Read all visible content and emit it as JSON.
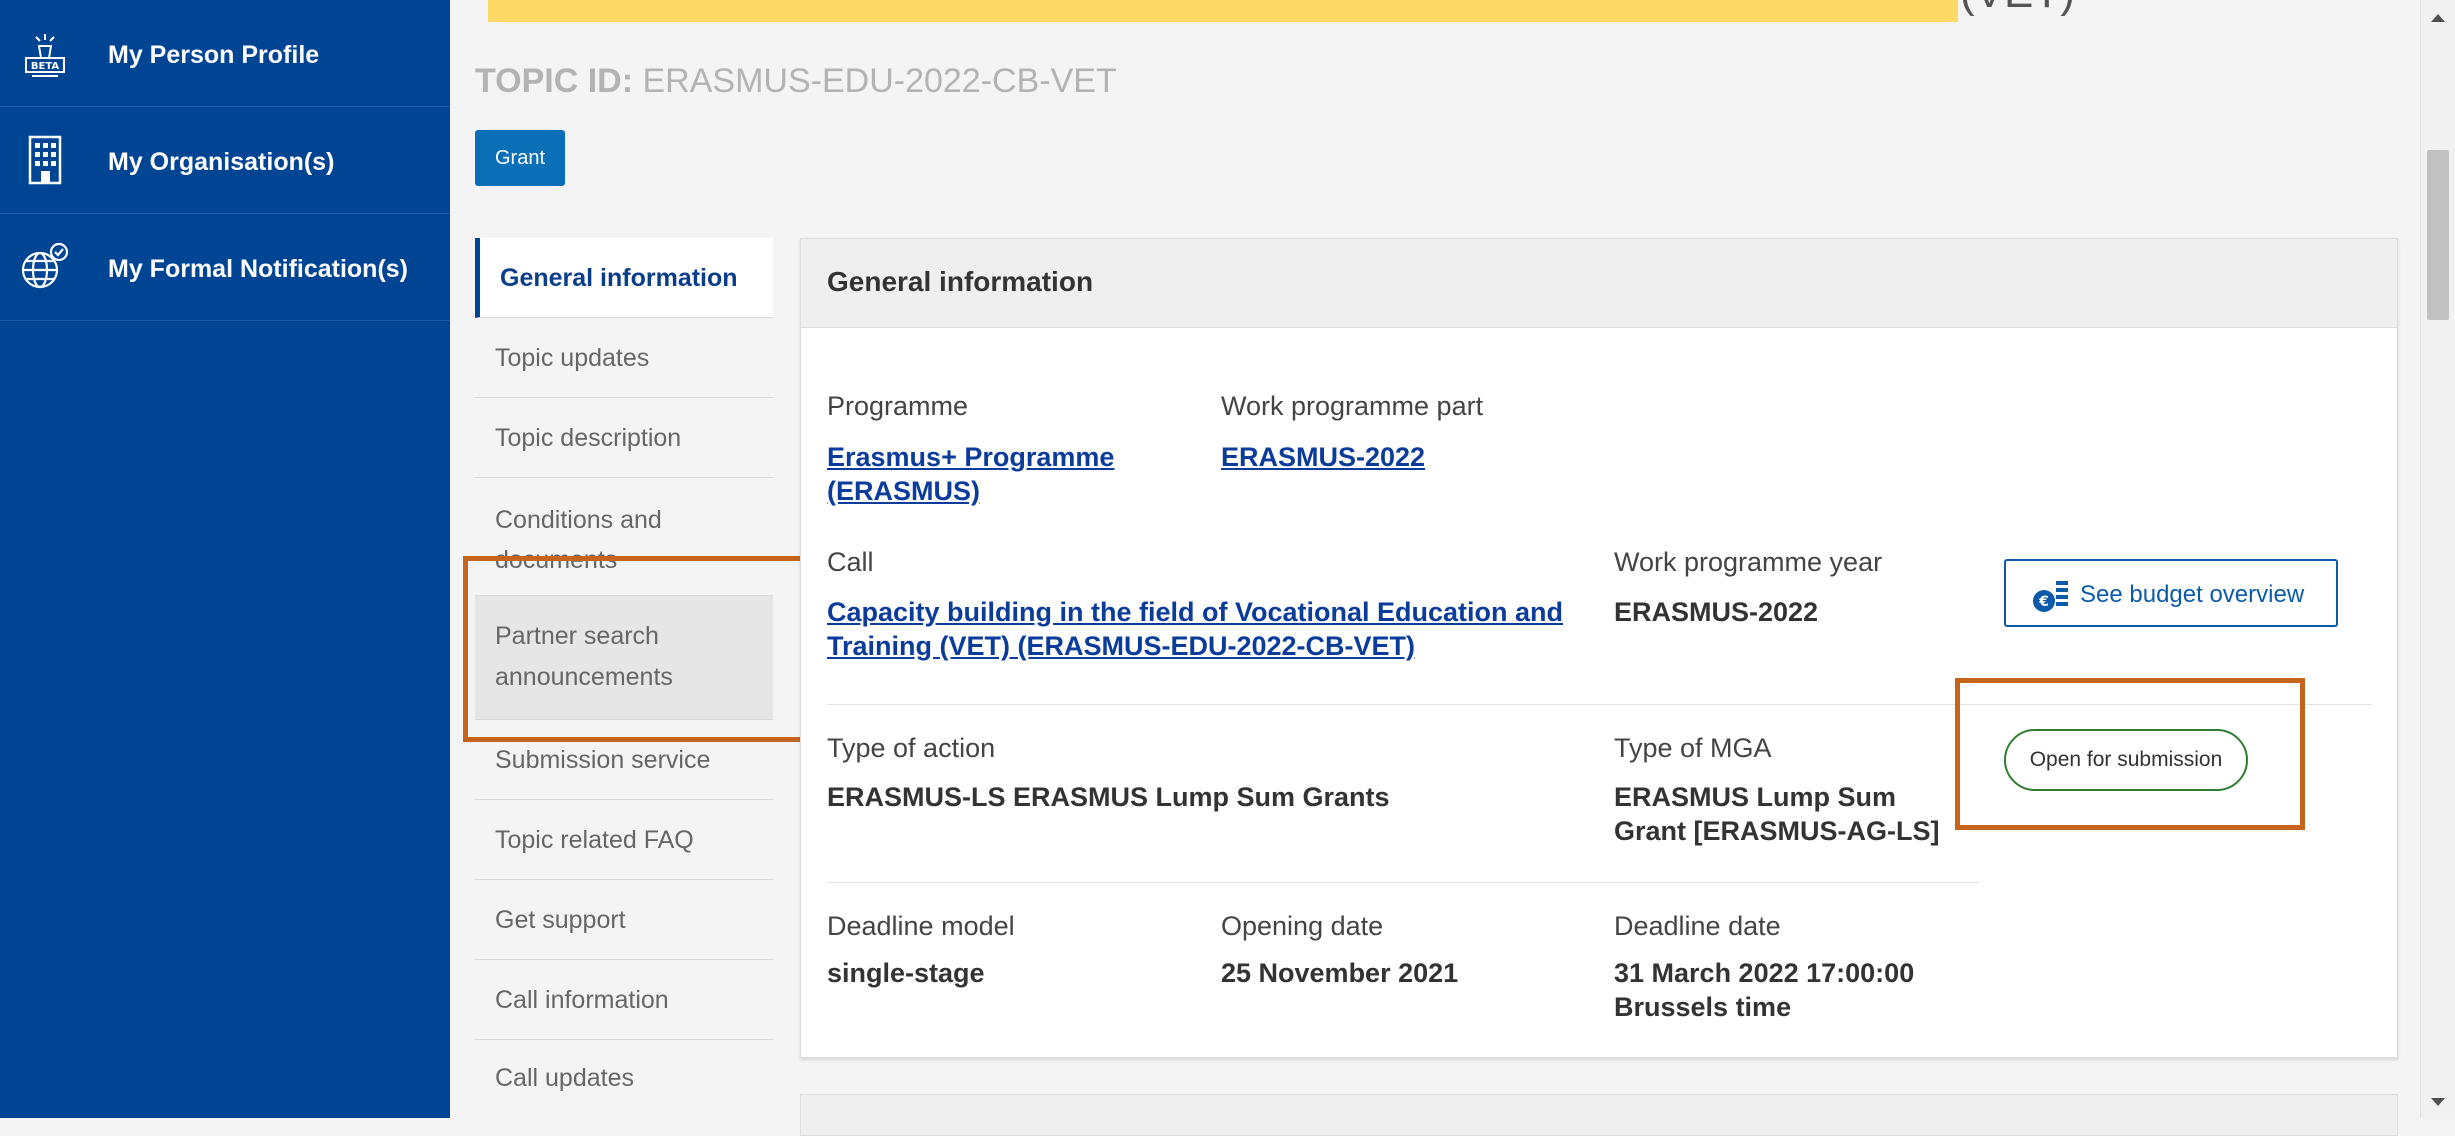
{
  "nav": {
    "items": [
      {
        "label": "My Person Profile",
        "icon": "beta-lighthouse-icon"
      },
      {
        "label": "My Organisation(s)",
        "icon": "building-icon"
      },
      {
        "label": "My Formal Notification(s)",
        "icon": "globe-notification-icon"
      }
    ]
  },
  "header": {
    "title_tail": "(VET)",
    "topic_id_label": "TOPIC ID:",
    "topic_id": "ERASMUS-EDU-2022-CB-VET",
    "badge": "Grant"
  },
  "menu": {
    "items": [
      "General information",
      "Topic updates",
      "Topic description",
      "Conditions and documents",
      "Partner search announcements",
      "Submission service",
      "Topic related FAQ",
      "Get support",
      "Call information",
      "Call updates"
    ]
  },
  "panel": {
    "title": "General information",
    "programme_label": "Programme",
    "programme_value": "Erasmus+ Programme (ERASMUS)",
    "wpp_label": "Work programme part",
    "wpp_value": "ERASMUS-2022",
    "call_label": "Call",
    "call_value": "Capacity building in the field of Vocational Education and Training (VET) (ERASMUS-EDU-2022-CB-VET)",
    "wpy_label": "Work programme year",
    "wpy_value": "ERASMUS-2022",
    "budget_button": "See budget overview",
    "action_label": "Type of action",
    "action_value": "ERASMUS-LS ERASMUS Lump Sum Grants",
    "mga_label": "Type of MGA",
    "mga_value": "ERASMUS Lump Sum Grant [ERASMUS-AG-LS]",
    "status": "Open for submission",
    "deadline_model_label": "Deadline model",
    "deadline_model_value": "single-stage",
    "opening_label": "Opening date",
    "opening_value": "25 November 2021",
    "deadline_label": "Deadline date",
    "deadline_value": "31 March 2022 17:00:00 Brussels time"
  },
  "colors": {
    "nav_bg": "#004494",
    "highlight": "#ffd966",
    "annotation": "#c5651c",
    "link": "#0b3c9b",
    "status_border": "#2e7d32"
  }
}
